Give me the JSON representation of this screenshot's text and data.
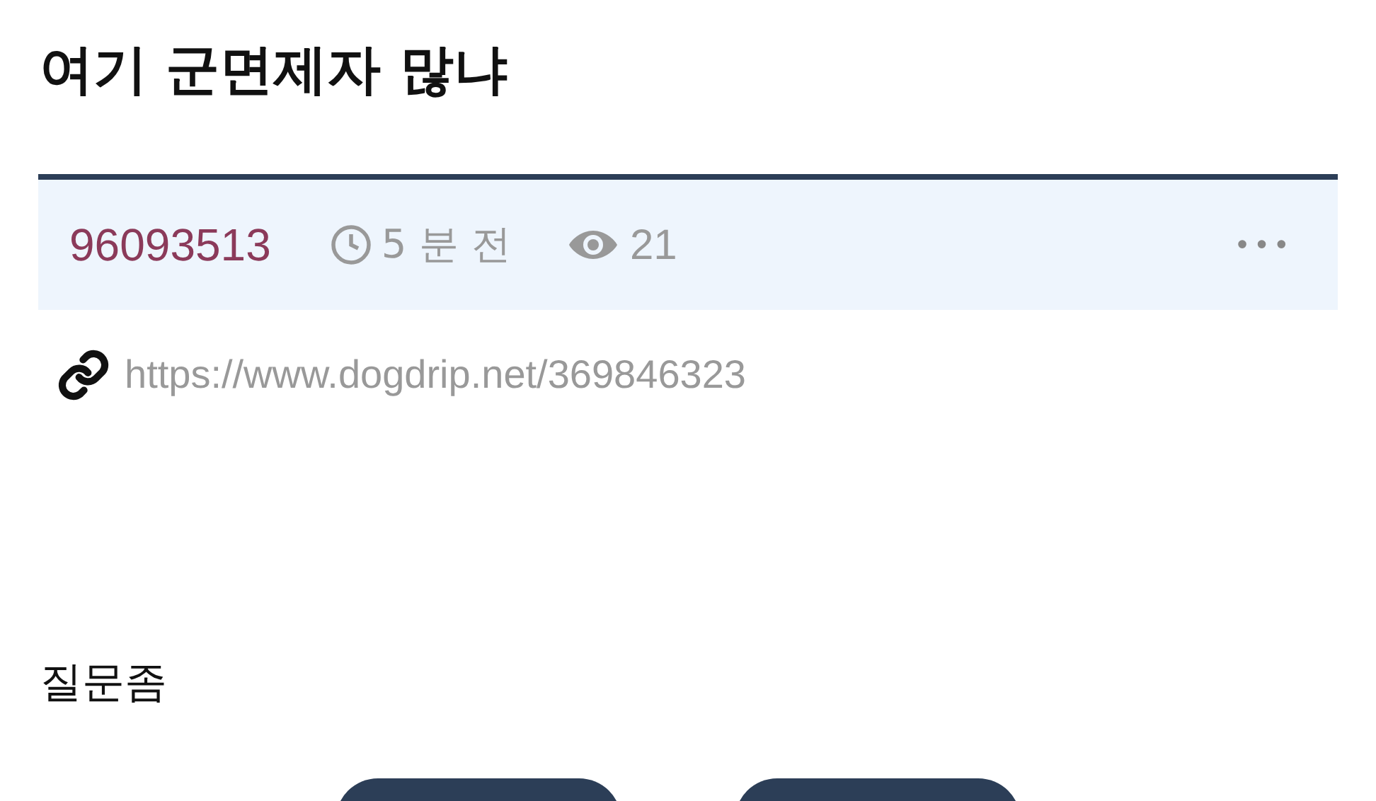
{
  "post": {
    "title": "여기 군면제자 많냐",
    "author": "96093513",
    "time": "5 분 전",
    "views": "21",
    "menu": "•••",
    "url": "https://www.dogdrip.net/369846323",
    "body": "질문좀"
  },
  "buttons": [
    {
      "kind": "vote"
    },
    {
      "kind": "vote"
    }
  ]
}
